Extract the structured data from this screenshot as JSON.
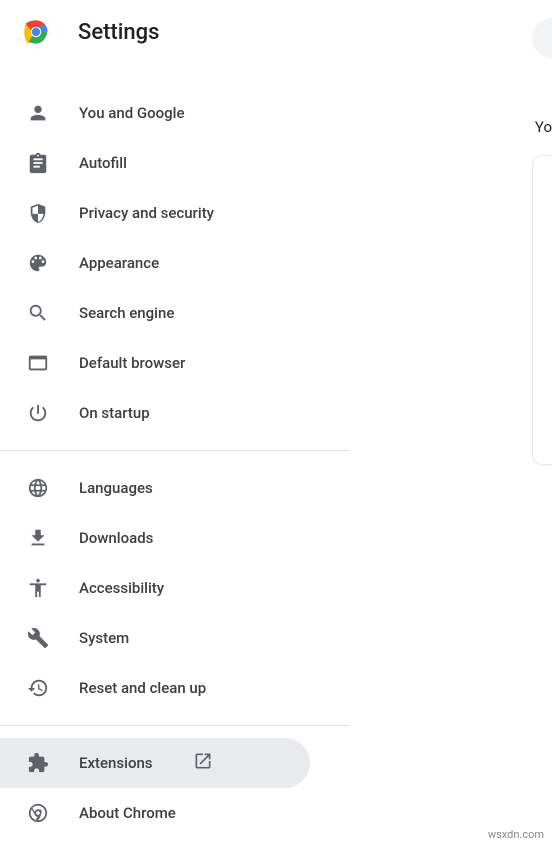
{
  "header": {
    "title": "Settings"
  },
  "menu": {
    "group1": [
      {
        "icon": "person",
        "label": "You and Google"
      },
      {
        "icon": "clipboard",
        "label": "Autofill"
      },
      {
        "icon": "shield",
        "label": "Privacy and security"
      },
      {
        "icon": "palette",
        "label": "Appearance"
      },
      {
        "icon": "search",
        "label": "Search engine"
      },
      {
        "icon": "browser",
        "label": "Default browser"
      },
      {
        "icon": "power",
        "label": "On startup"
      }
    ],
    "group2": [
      {
        "icon": "globe",
        "label": "Languages"
      },
      {
        "icon": "download",
        "label": "Downloads"
      },
      {
        "icon": "accessibility",
        "label": "Accessibility"
      },
      {
        "icon": "wrench",
        "label": "System"
      },
      {
        "icon": "restore",
        "label": "Reset and clean up"
      }
    ],
    "group3": [
      {
        "icon": "puzzle",
        "label": "Extensions",
        "external": true,
        "selected": true
      },
      {
        "icon": "chrome-outline",
        "label": "About Chrome"
      }
    ]
  },
  "partial": {
    "text": "Yo"
  },
  "watermark": "wsxdn.com"
}
